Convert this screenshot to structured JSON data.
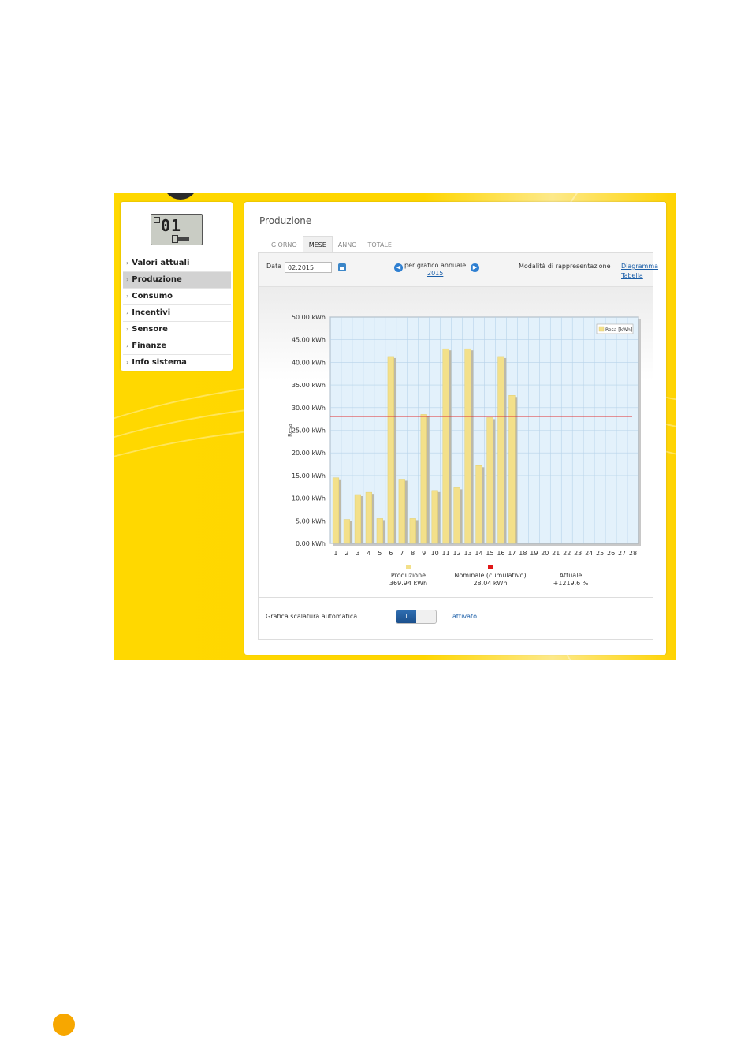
{
  "sidebar": {
    "lcd_digits": "01",
    "items": [
      {
        "label": "Valori attuali",
        "active": false
      },
      {
        "label": "Produzione",
        "active": true
      },
      {
        "label": "Consumo",
        "active": false
      },
      {
        "label": "Incentivi",
        "active": false
      },
      {
        "label": "Sensore",
        "active": false
      },
      {
        "label": "Finanze",
        "active": false
      },
      {
        "label": "Info sistema",
        "active": false
      }
    ]
  },
  "panel": {
    "title": "Produzione",
    "tabs": [
      {
        "label": "GIORNO",
        "active": false
      },
      {
        "label": "MESE",
        "active": true
      },
      {
        "label": "ANNO",
        "active": false
      },
      {
        "label": "TOTALE",
        "active": false
      }
    ]
  },
  "controls": {
    "date_label": "Data",
    "date_value": "02.2015",
    "nav_label": "per grafico annuale",
    "nav_year": "2015",
    "mode_label": "Modalità di rappresentazione",
    "mode_diagram": "Diagramma",
    "mode_table": "Tabella"
  },
  "chart_data": {
    "type": "bar",
    "ylabel": "Resa",
    "ylim": [
      0,
      50
    ],
    "yticks": [
      "0.00 kWh",
      "5.00 kWh",
      "10.00 kWh",
      "15.00 kWh",
      "20.00 kWh",
      "25.00 kWh",
      "30.00 kWh",
      "35.00 kWh",
      "40.00 kWh",
      "45.00 kWh",
      "50.00 kWh"
    ],
    "categories": [
      "1",
      "2",
      "3",
      "4",
      "5",
      "6",
      "7",
      "8",
      "9",
      "10",
      "11",
      "12",
      "13",
      "14",
      "15",
      "16",
      "17",
      "18",
      "19",
      "20",
      "21",
      "22",
      "23",
      "24",
      "25",
      "26",
      "27",
      "28"
    ],
    "series": [
      {
        "name": "Resa [kWh]",
        "color": "#f3e08a",
        "values": [
          14.5,
          5.3,
          10.8,
          11.3,
          5.5,
          41.3,
          14.2,
          5.5,
          28.5,
          11.7,
          43.0,
          12.3,
          43.0,
          17.2,
          27.8,
          41.3,
          32.7,
          null,
          null,
          null,
          null,
          null,
          null,
          null,
          null,
          null,
          null,
          null
        ]
      }
    ],
    "reference_line": {
      "value": 28.04,
      "color": "#e03030"
    },
    "legend": {
      "position": "top-right"
    },
    "grid": true,
    "summary": [
      {
        "label": "Produzione",
        "value": "369.94 kWh",
        "color": "#f3e08a"
      },
      {
        "label": "Nominale (cumulativo)",
        "value": "28.04 kWh",
        "color": "#e01818"
      },
      {
        "label": "Attuale",
        "value": "+1219.6 %",
        "color": ""
      }
    ]
  },
  "footer": {
    "label": "Grafica scalatura automatica",
    "toggle_text": "I",
    "state": "attivato"
  }
}
